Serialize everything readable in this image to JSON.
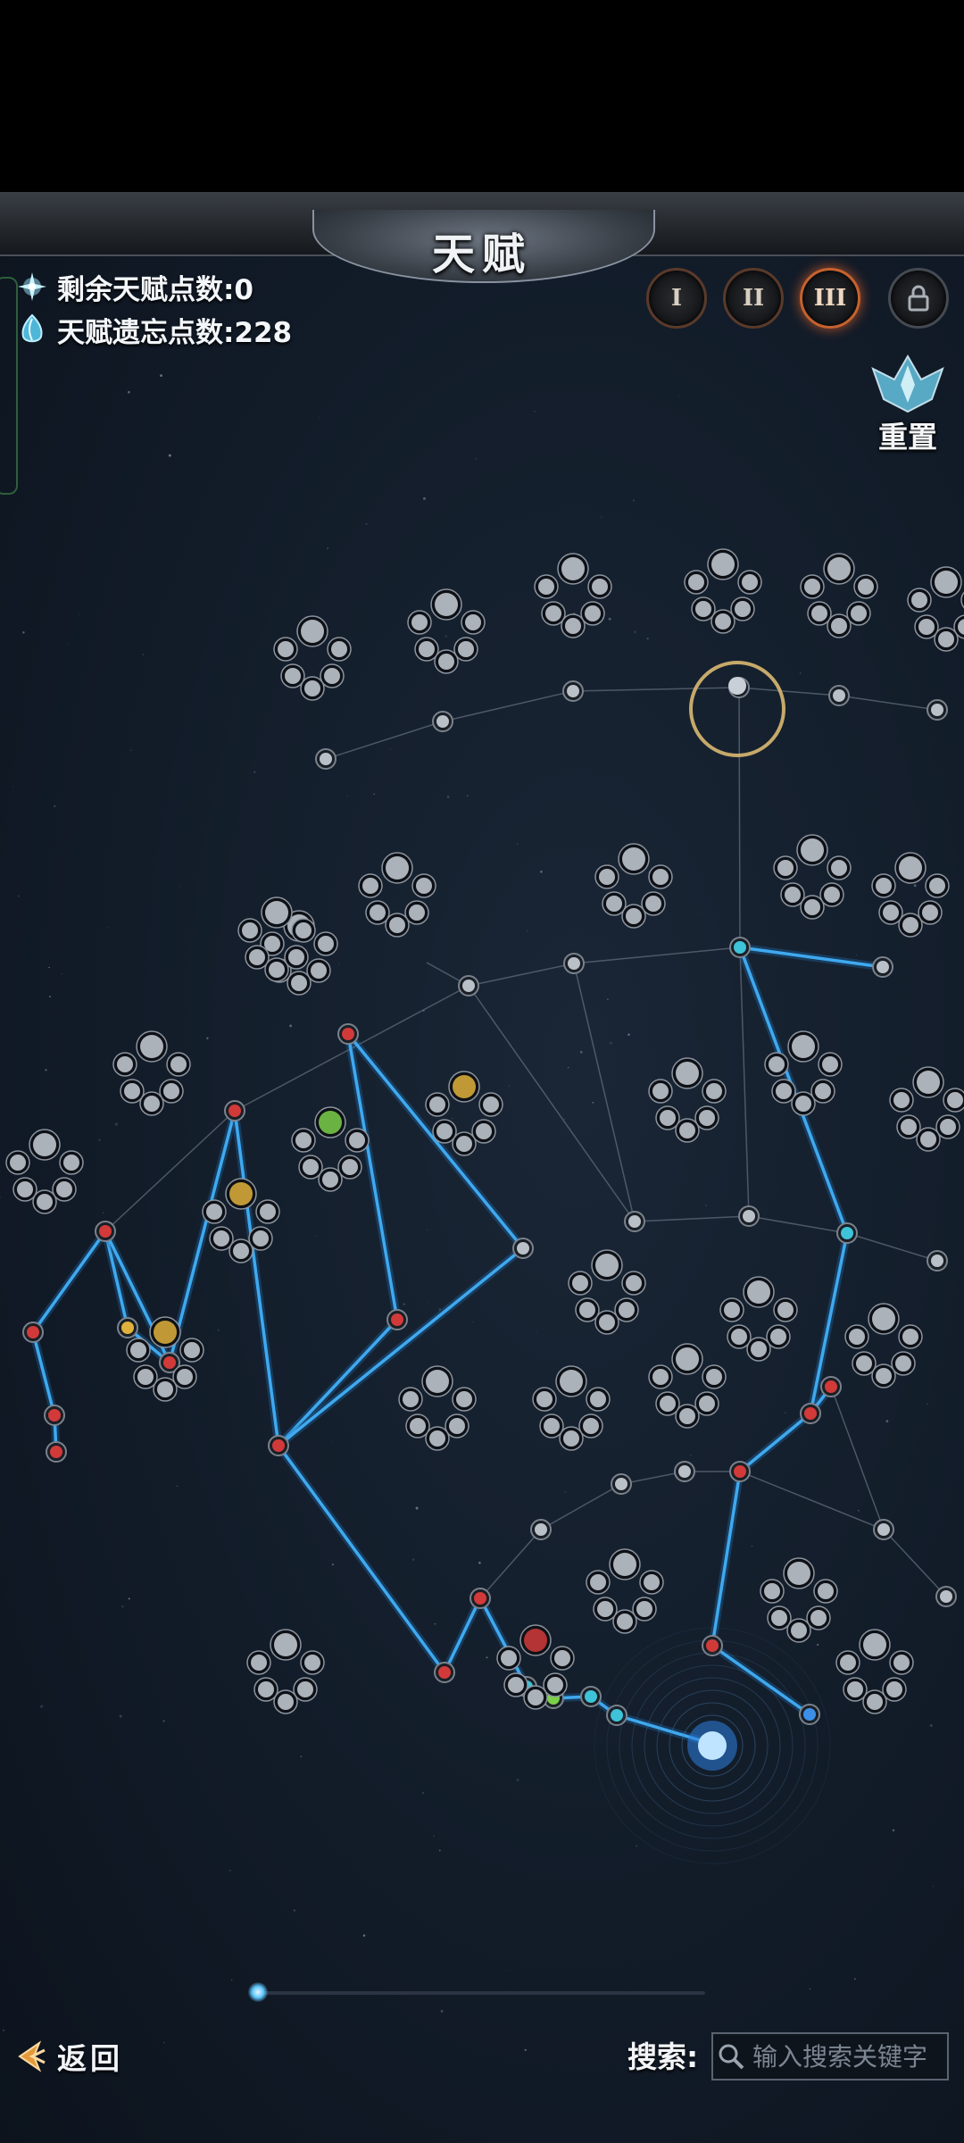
{
  "header": {
    "title": "天赋"
  },
  "stats": {
    "remaining_points": "剩余天赋点数:0",
    "forget_points": "天赋遗忘点数:228"
  },
  "tiers": [
    {
      "label": "I",
      "state": "normal",
      "icon": "tier-1-icon"
    },
    {
      "label": "II",
      "state": "normal",
      "icon": "tier-2-icon"
    },
    {
      "label": "III",
      "state": "active",
      "icon": "tier-3-icon"
    },
    {
      "label": "",
      "state": "locked",
      "icon": "lock-icon"
    }
  ],
  "reset": {
    "label": "重置",
    "icon": "reset-crystal-icon"
  },
  "footer": {
    "back_label": "返回",
    "search_label": "搜索:",
    "search_placeholder": "输入搜索关键字"
  },
  "colors": {
    "active_link": "#3fa9ef",
    "inactive_link": "#5b6675",
    "node_silver": "#b9c0c8",
    "node_red": "#d23a3a",
    "node_cyan": "#3ec3d8",
    "node_green": "#7bd04a",
    "node_gold": "#e0b23c",
    "selection_ring": "#d9b871"
  }
}
